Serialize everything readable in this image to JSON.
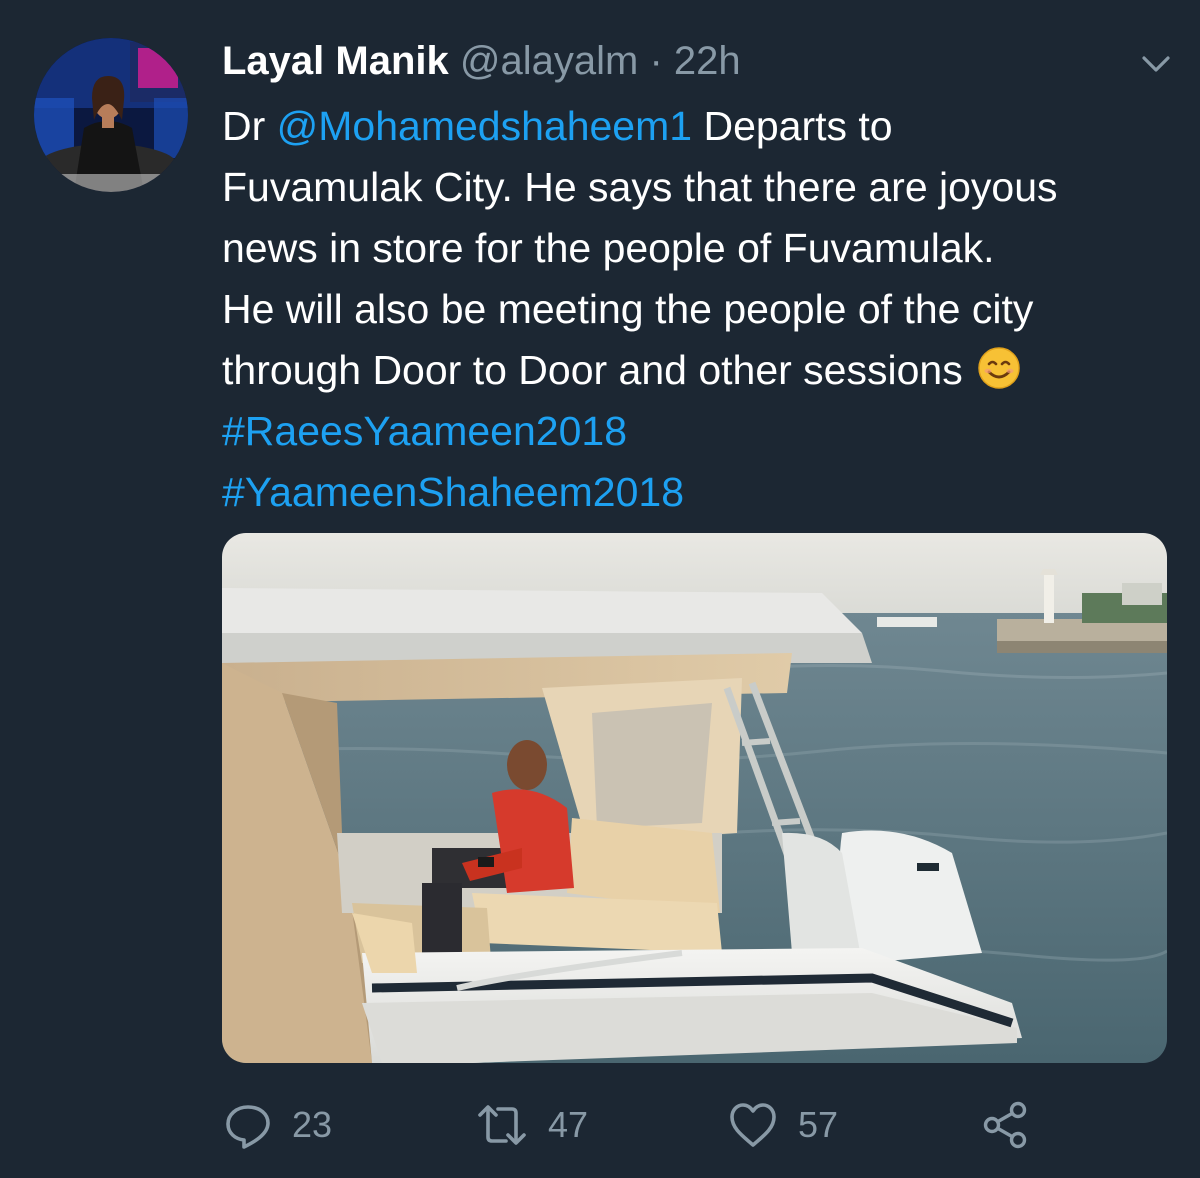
{
  "tweet": {
    "author": {
      "display_name": "Layal Manik",
      "handle": "@alayalm",
      "separator": "·",
      "time": "22h"
    },
    "text": {
      "line1_prefix": "Dr ",
      "mention": "@Mohamedshaheem1",
      "line1_suffix": " Departs to",
      "line2": "Fuvamulak City. He says that there are joyous",
      "line3": "news in store for the people of Fuvamulak.",
      "line4": "He will also be meeting the people of the city",
      "line5": "through Door to Door and other sessions",
      "hashtag1": "#RaeesYaameen2018",
      "hashtag2": "#YaameenShaheem2018"
    },
    "media": {
      "type": "photo",
      "icon": "photo-boat"
    },
    "actions": {
      "reply_count": "23",
      "retweet_count": "47",
      "like_count": "57"
    }
  },
  "colors": {
    "background": "#1c2733",
    "text": "#ffffff",
    "secondary": "#8899a6",
    "link": "#1da1f2"
  },
  "icons": {
    "menu": "chevron-down-icon",
    "reply": "reply-icon",
    "retweet": "retweet-icon",
    "like": "heart-icon",
    "share": "share-icon",
    "emoji": "smiling-face-emoji"
  }
}
